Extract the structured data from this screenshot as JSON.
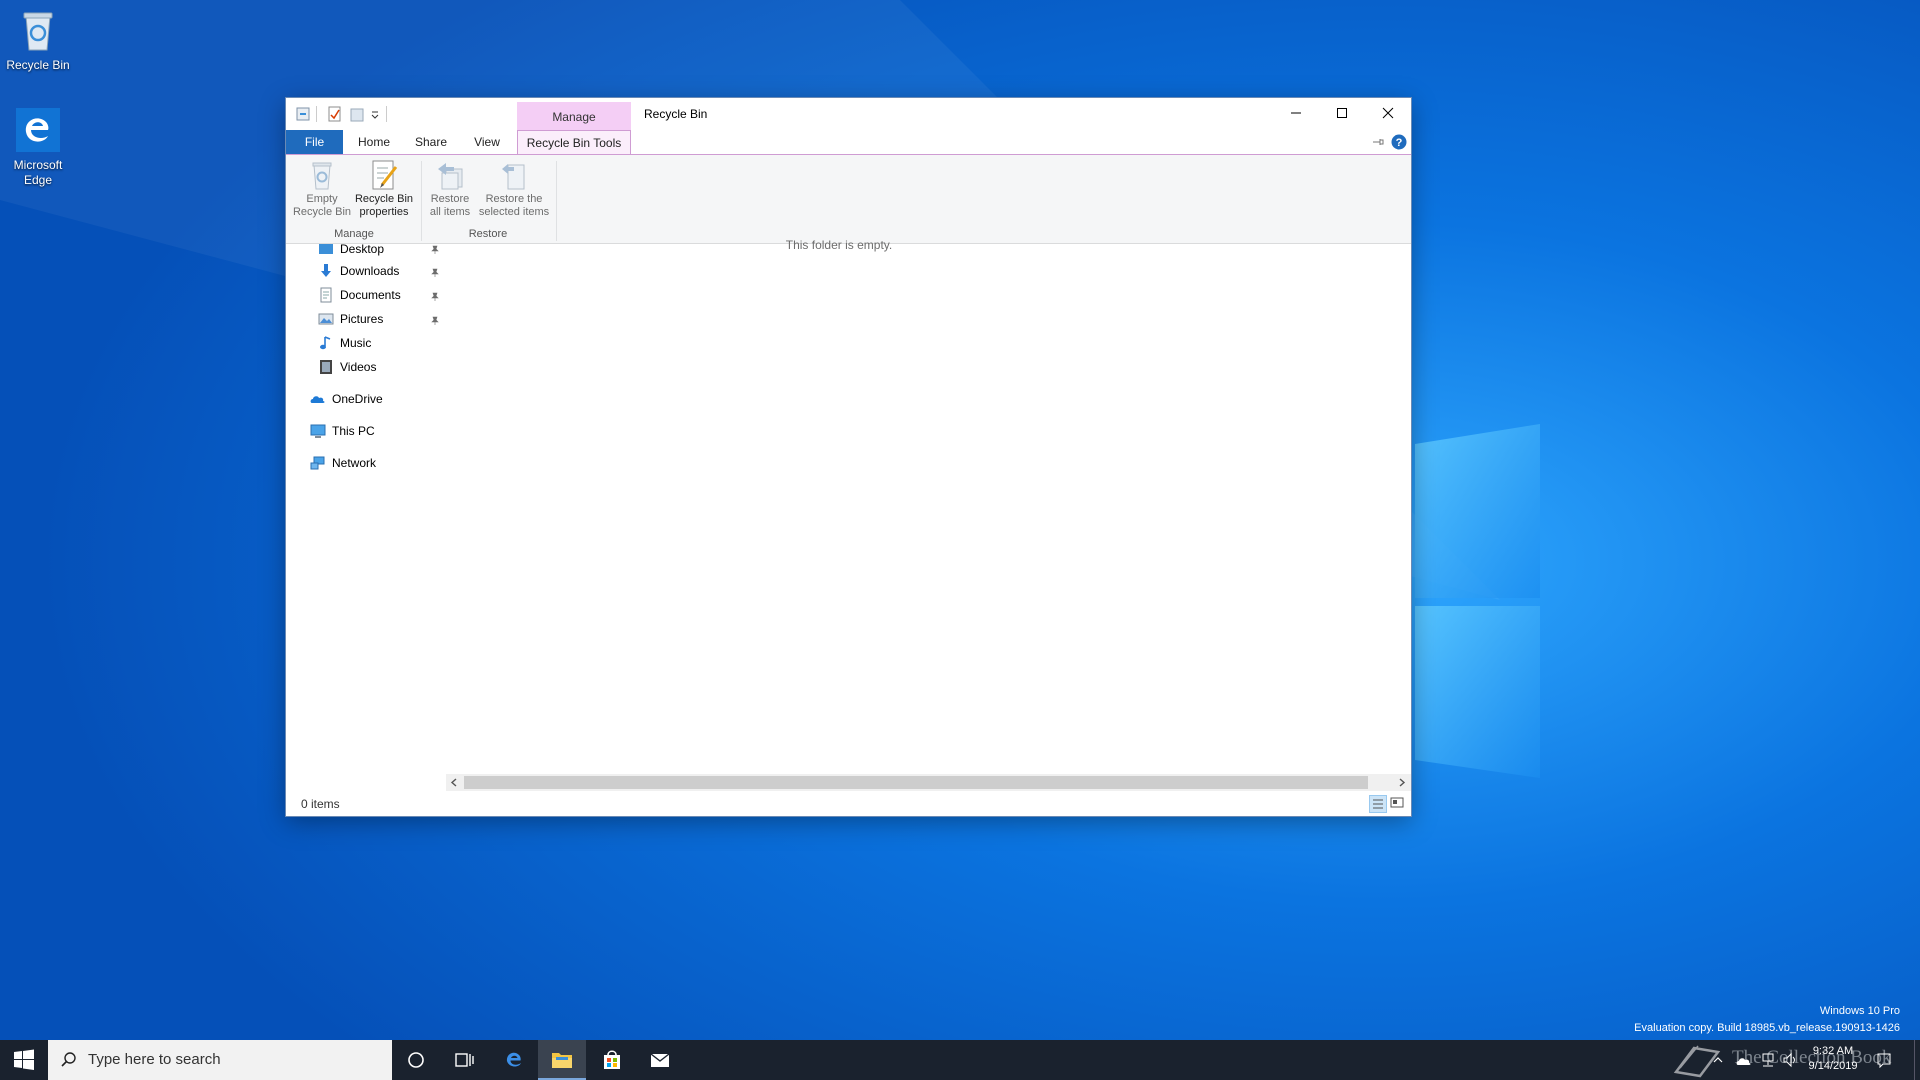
{
  "desktop": {
    "icons": [
      {
        "label": "Recycle Bin"
      },
      {
        "label": "Microsoft Edge"
      }
    ],
    "watermark": {
      "line1": "Windows 10 Pro",
      "line2": "Evaluation copy. Build 18985.vb_release.190913-1426"
    },
    "overlay_text": "The Collection Book"
  },
  "window": {
    "title": "Recycle Bin",
    "context_tab_group": "Manage",
    "tabs": [
      "File",
      "Home",
      "Share",
      "View",
      "Recycle Bin Tools"
    ],
    "ribbon": {
      "groups": [
        {
          "label": "Manage",
          "buttons": [
            {
              "line1": "Empty",
              "line2": "Recycle Bin"
            },
            {
              "line1": "Recycle Bin",
              "line2": "properties"
            }
          ]
        },
        {
          "label": "Restore",
          "buttons": [
            {
              "line1": "Restore",
              "line2": "all items"
            },
            {
              "line1": "Restore the",
              "line2": "selected items"
            }
          ]
        }
      ]
    },
    "nav": {
      "items": [
        {
          "label": "Desktop"
        },
        {
          "label": "Downloads"
        },
        {
          "label": "Documents"
        },
        {
          "label": "Pictures"
        },
        {
          "label": "Music"
        },
        {
          "label": "Videos"
        },
        {
          "label": "OneDrive"
        },
        {
          "label": "This PC"
        },
        {
          "label": "Network"
        }
      ]
    },
    "content": {
      "empty_message": "This folder is empty."
    },
    "status": {
      "item_count": "0 items"
    }
  },
  "taskbar": {
    "search_placeholder": "Type here to search",
    "clock": {
      "time": "9:32 AM",
      "date": "9/14/2019"
    }
  },
  "colors": {
    "accent": "#1f6bbd",
    "context_tab": "#f4cef5",
    "taskbar": "#1a222e",
    "desktop": "#0a64d2"
  }
}
